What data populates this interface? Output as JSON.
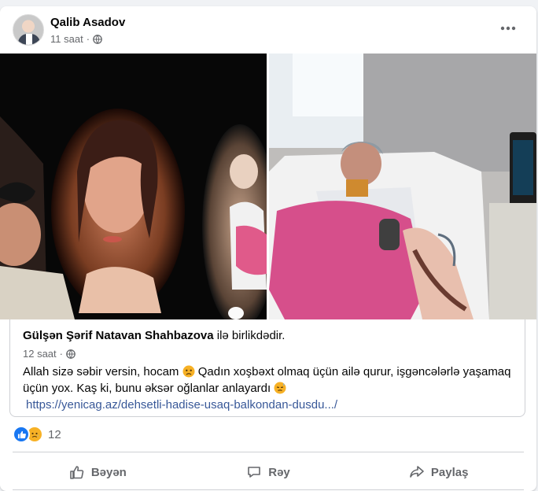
{
  "post": {
    "author": "Qalib Asadov",
    "time": "11 saat",
    "privacy_icon": "globe-icon",
    "menu_icon": "more-options-icon"
  },
  "shared_post": {
    "author": "Gülşən Şərif Natavan Shahbazova",
    "with_text": "ilə birlikdədir.",
    "time": "12 saat",
    "text_part1": "Allah sizə səbir versin, hocam",
    "text_part2": "Qadın xoşbəxt olmaq üçün ailə qurur, işgəncələrlə yaşamaq üçün yox. Kaş ki, bunu əksər oğlanlar anlayardı",
    "link": "https://yenicag.az/dehsetli-hadise-usaq-balkondan-dusdu.../"
  },
  "reactions": {
    "count": "12",
    "icons": [
      "like-icon",
      "sad-icon"
    ]
  },
  "actions": {
    "like": "Bəyən",
    "comment": "Rəy",
    "share": "Paylaş"
  },
  "colors": {
    "link": "#385898",
    "like_blue": "#1877f2",
    "sad_yellow": "#f7b125",
    "secondary_text": "#65676b",
    "page_bg": "#f0f2f5"
  }
}
